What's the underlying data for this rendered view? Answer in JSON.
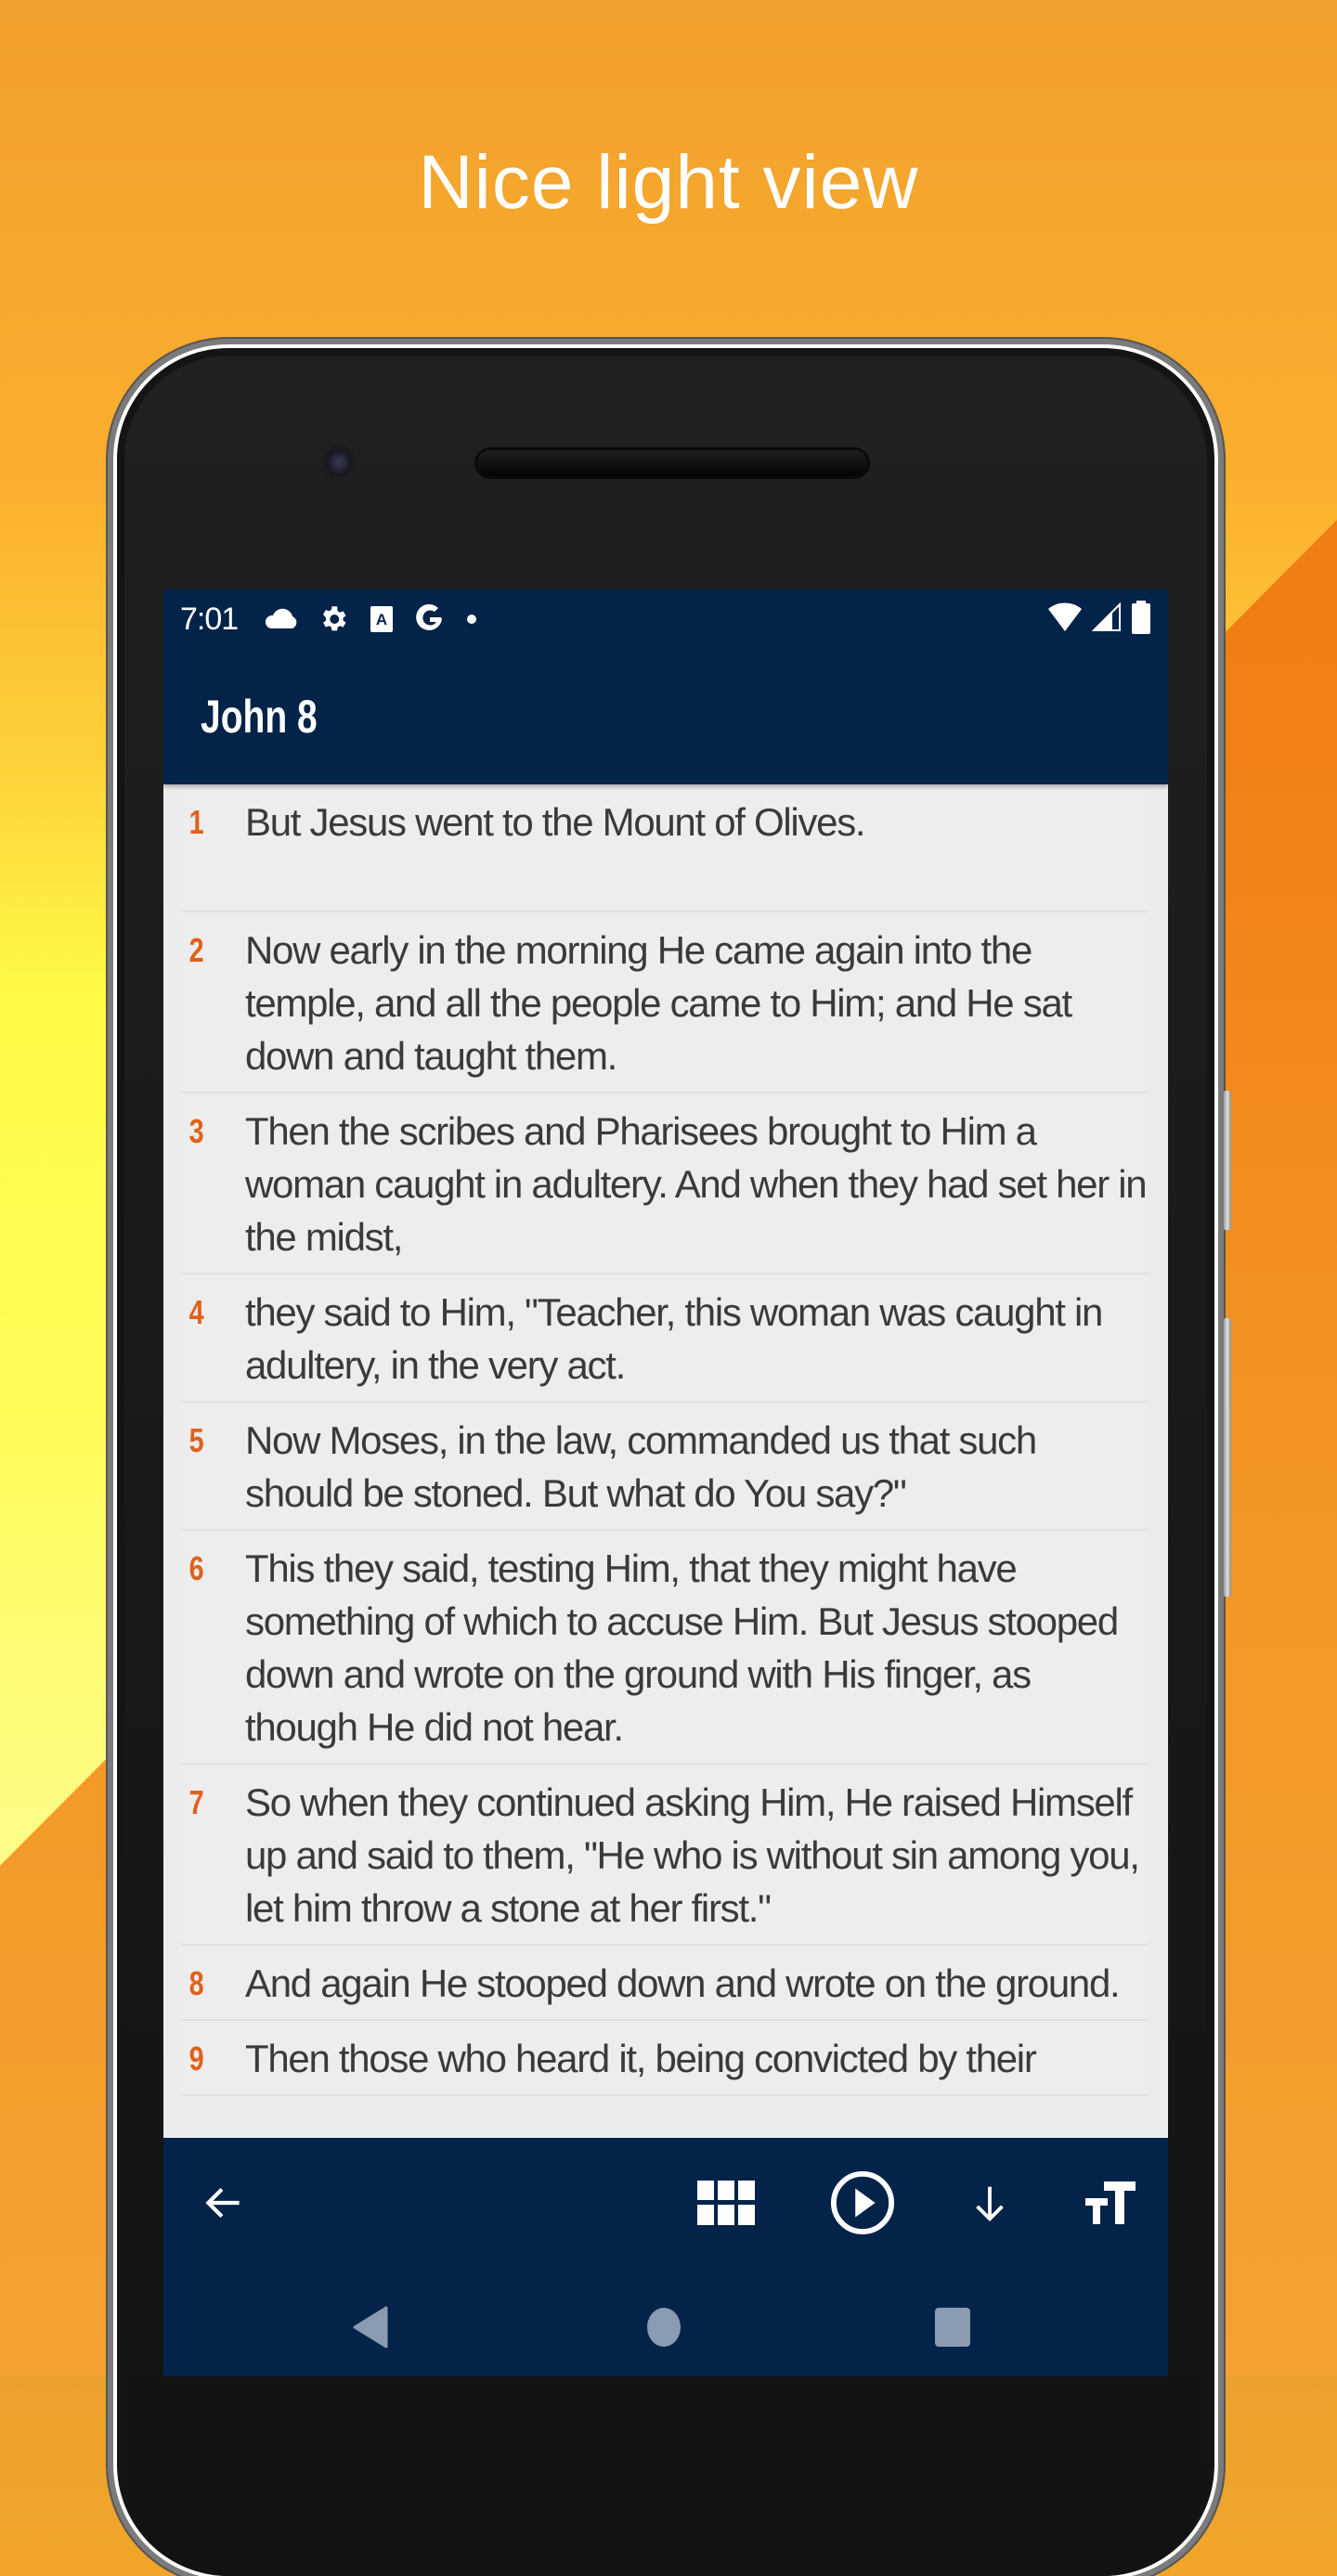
{
  "promo": {
    "headline": "Nice light view"
  },
  "status_bar": {
    "time": "7:01",
    "left_icons": [
      "cloud-icon",
      "gear-icon",
      "translate-a-icon",
      "google-g-icon",
      "dot-icon"
    ],
    "right_icons": [
      "wifi-icon",
      "signal-icon",
      "battery-icon"
    ]
  },
  "app_bar": {
    "title": "John 8"
  },
  "verses": [
    {
      "num": "1",
      "text": "But Jesus went to the Mount of Olives."
    },
    {
      "num": "2",
      "text": "Now early in the morning He came again into the temple, and all the people came to Him; and He sat down and taught them."
    },
    {
      "num": "3",
      "text": "Then the scribes and Pharisees brought to Him a woman caught in adultery. And when they had set her in the midst,"
    },
    {
      "num": "4",
      "text": "they said to Him, \"Teacher, this woman was caught in adultery, in the very act."
    },
    {
      "num": "5",
      "text": "Now Moses, in the law, commanded us that such should be stoned. But what do You say?\""
    },
    {
      "num": "6",
      "text": "This they said, testing Him, that they might have something of which to accuse Him. But Jesus stooped down and wrote on the ground with His finger, as though He did not hear."
    },
    {
      "num": "7",
      "text": "So when they continued asking Him, He raised Himself up and said to them, \"He who is without sin among you, let him throw a stone at her first.\""
    },
    {
      "num": "8",
      "text": "And again He stooped down and wrote on the ground."
    },
    {
      "num": "9",
      "text": "Then those who heard it, being convicted by their"
    }
  ],
  "toolbar": {
    "buttons": [
      "back-arrow-icon",
      "grid-icon",
      "play-circle-icon",
      "download-arrow-icon",
      "text-size-icon"
    ]
  },
  "nav_bar": {
    "buttons": [
      "nav-back-icon",
      "nav-home-icon",
      "nav-recents-icon"
    ]
  },
  "colors": {
    "app_bar": "#032349",
    "verse_number": "#e0611a",
    "verse_text": "#3a3a3a",
    "content_bg": "#ececec"
  }
}
